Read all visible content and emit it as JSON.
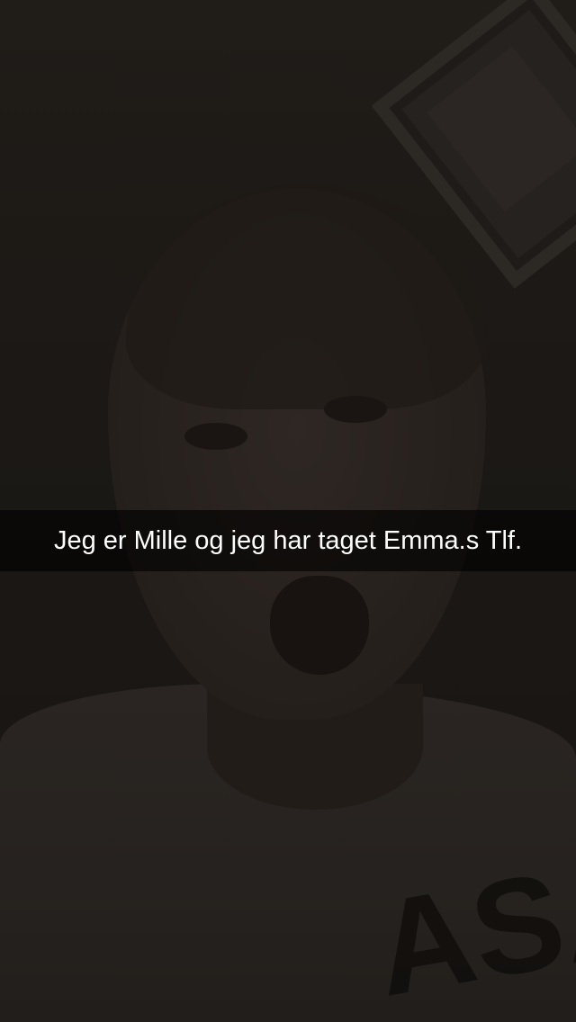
{
  "snap": {
    "caption": "Jeg er Mille og jeg har taget Emma.s Tlf.",
    "shirt_print": "ASA"
  },
  "colors": {
    "caption_bar": "#000000",
    "caption_text": "#ffffff",
    "background": "#1a1714"
  }
}
